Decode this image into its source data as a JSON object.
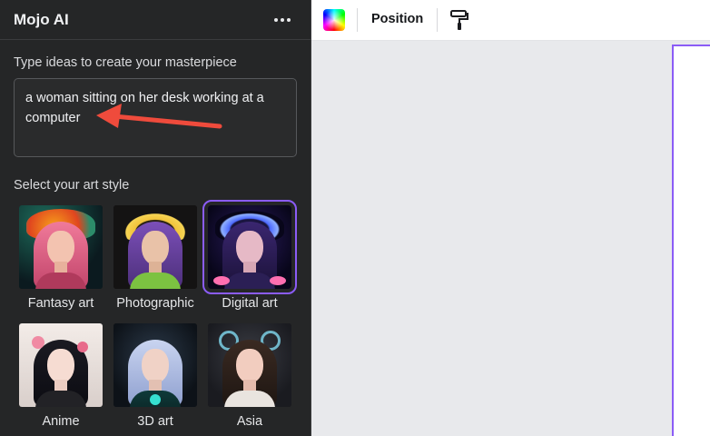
{
  "panel": {
    "title": "Mojo AI",
    "prompt_label": "Type ideas to create your masterpiece",
    "prompt_text": "a woman sitting on her desk working at a computer",
    "style_label": "Select your art style",
    "styles": [
      {
        "label": "Fantasy art",
        "selected": false
      },
      {
        "label": "Photographic",
        "selected": false
      },
      {
        "label": "Digital art",
        "selected": true
      },
      {
        "label": "Anime",
        "selected": false
      },
      {
        "label": "3D art",
        "selected": false
      },
      {
        "label": "Asia",
        "selected": false
      }
    ]
  },
  "toolbar": {
    "position_label": "Position"
  },
  "colors": {
    "panel_bg": "#252627",
    "selection_accent": "#8b5cf6",
    "arrow": "#ef4b3c",
    "canvas_bg": "#e8e9ec"
  },
  "icons": [
    "more-icon",
    "color-picker-icon",
    "paint-roller-icon",
    "chevron-left-icon"
  ]
}
